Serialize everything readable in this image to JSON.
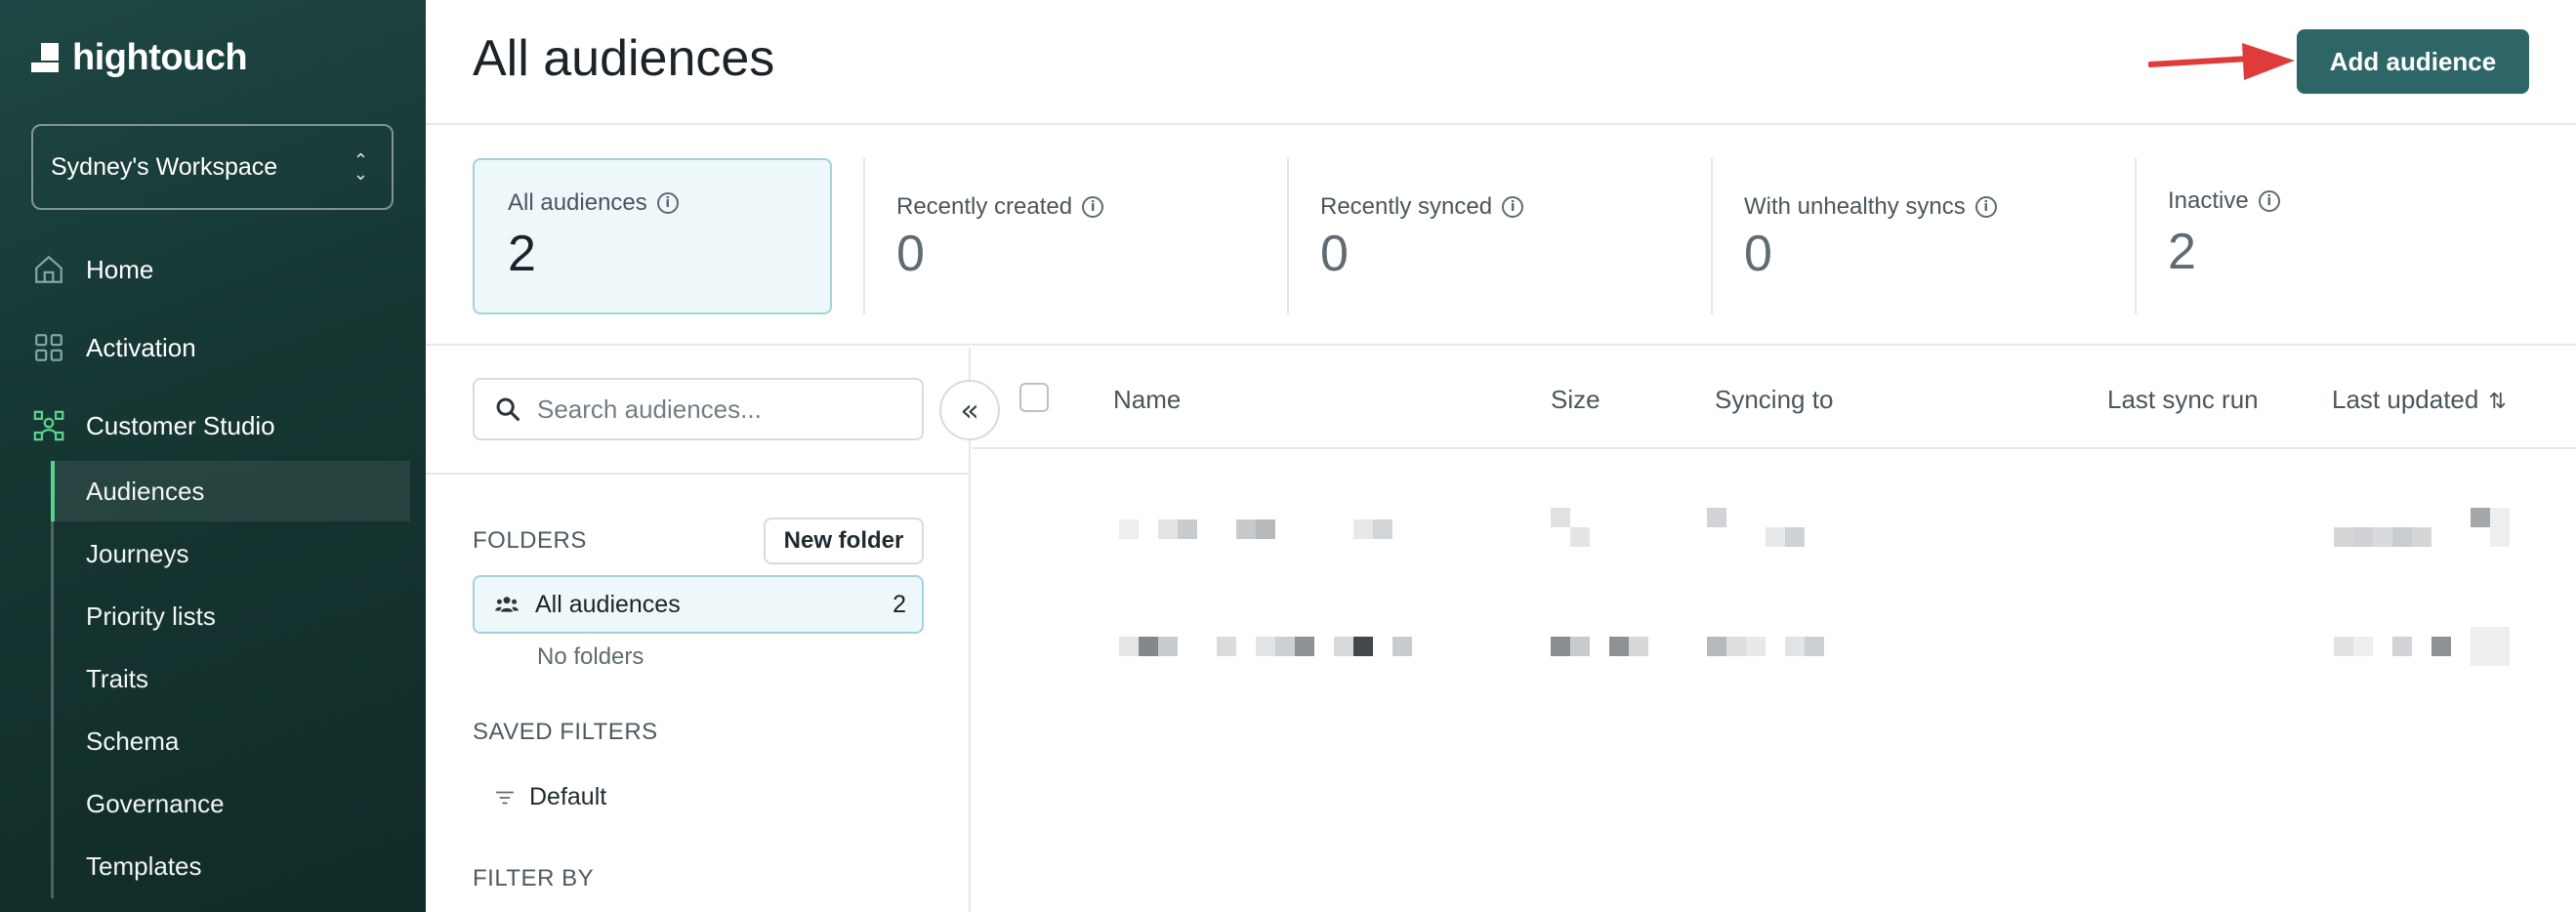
{
  "app": {
    "logo_text": "hightouch",
    "workspace": "Sydney's Workspace"
  },
  "sidebar": {
    "items": [
      {
        "label": "Home",
        "icon": "home-icon"
      },
      {
        "label": "Activation",
        "icon": "activation-icon"
      },
      {
        "label": "Customer Studio",
        "icon": "customer-studio-icon"
      }
    ],
    "subitems": [
      "Audiences",
      "Journeys",
      "Priority lists",
      "Traits",
      "Schema",
      "Governance",
      "Templates"
    ],
    "active_subitem": "Audiences"
  },
  "header": {
    "title": "All audiences",
    "add_button": "Add audience"
  },
  "stats": [
    {
      "label": "All audiences",
      "value": "2"
    },
    {
      "label": "Recently created",
      "value": "0"
    },
    {
      "label": "Recently synced",
      "value": "0"
    },
    {
      "label": "With unhealthy syncs",
      "value": "0"
    },
    {
      "label": "Inactive",
      "value": "2"
    }
  ],
  "panel": {
    "search_placeholder": "Search audiences...",
    "folders_title": "FOLDERS",
    "new_folder": "New folder",
    "folder_all": "All audiences",
    "folder_all_count": "2",
    "no_folders": "No folders",
    "saved_filters_title": "SAVED FILTERS",
    "default_filter": "Default",
    "filter_by_title": "FILTER BY"
  },
  "table": {
    "columns": [
      "Name",
      "Size",
      "Syncing to",
      "Last sync run",
      "Last updated"
    ]
  },
  "colors": {
    "sidebar": "#163733",
    "accent": "#2e6567",
    "active_indicator": "#57d38c",
    "annotation_arrow": "#e03b3b"
  }
}
